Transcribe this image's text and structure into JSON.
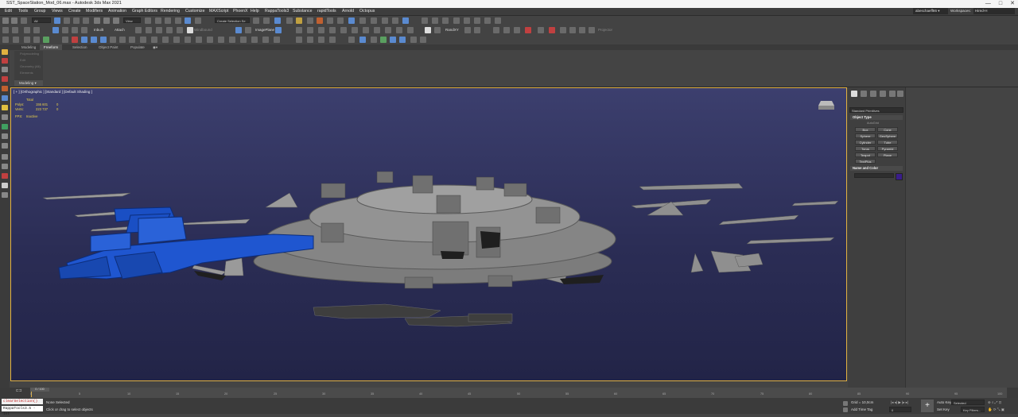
{
  "titlebar": {
    "title": "SST_SpaceStation_Mod_06.max - Autodesk 3ds Max 2021",
    "minimize": "—",
    "maximize": "□",
    "close": "✕"
  },
  "menu": [
    "Edit",
    "Tools",
    "Group",
    "Views",
    "Create",
    "Modifiers",
    "Animation",
    "Graph Editors",
    "Rendering",
    "Customize",
    "MAXScript",
    "PhoenX",
    "Help",
    "RappaTools3",
    "Substance",
    "rapidTools",
    "Arnold",
    "Octopus"
  ],
  "user": {
    "name": "abeschaeff86",
    "dropdown_arrow": "▾"
  },
  "workspace": {
    "label": "Workspaces:",
    "value": "Hired-H"
  },
  "toolbar": {
    "filter_all": "All",
    "view_dropdown": "View",
    "create_selection_set": "Create Selection Se",
    "labels": [
      "Inbuilt",
      "Attach",
      "Windbound",
      "ImagePlane",
      "RandXY",
      "Projector"
    ]
  },
  "ribbon": {
    "tabs": [
      "Modeling",
      "Freeform",
      "Selection",
      "Object Paint",
      "Populate"
    ],
    "active_tab": "Freeform",
    "panel_items": [
      "Polymodeling",
      "Edit",
      "Geometry (All)",
      "Elements",
      "Subdivision"
    ],
    "panel_footer": "Modeling ▾"
  },
  "viewport": {
    "label": "[ + ] [Orthographic ] [Standard ] [Default Shading ]",
    "stats": {
      "header": "Total",
      "rows": [
        {
          "name": "Polys:",
          "total": "155 601",
          "sel": "0"
        },
        {
          "name": "Verts:",
          "total": "223 737",
          "sel": "0"
        }
      ],
      "fps_label": "FPS:",
      "fps_value": "Inactive"
    }
  },
  "command_panel": {
    "category": "Standard Primitives",
    "object_type_title": "Object Type",
    "autogrid": "AutoGrid",
    "primitives": [
      "Box",
      "Cone",
      "Sphere",
      "GeoSphere",
      "Cylinder",
      "Tube",
      "Torus",
      "Pyramid",
      "Teapot",
      "Plane",
      "TextPlus"
    ],
    "name_color_title": "Name and Color",
    "name_value": "",
    "object_color": "#3a1d8a"
  },
  "timeline": {
    "frame_display": "0 / 100",
    "ticks": [
      "0",
      "5",
      "10",
      "15",
      "20",
      "25",
      "30",
      "35",
      "40",
      "45",
      "50",
      "55",
      "60",
      "65",
      "70",
      "75",
      "80",
      "85",
      "90",
      "95",
      "100"
    ]
  },
  "status": {
    "maxscript_line1": "clearSelection()",
    "maxscript_line2": "RappaTools3.5 - Int",
    "selection_text": "None Selected",
    "prompt": "Click or drag to select objects",
    "grid": "Grid = 10,0cm",
    "add_time_tag": "Add Time Tag",
    "auto_key": "Auto Key",
    "set_key": "Set Key",
    "key_mode": "Selected",
    "key_filters": "Key Filters...",
    "frame": "0"
  },
  "colors": {
    "selection_blue": "#1a4fc4",
    "station_grey": "#7a7a7a",
    "viewport_bg": "#33366a",
    "viewport_border": "#e0b040"
  }
}
